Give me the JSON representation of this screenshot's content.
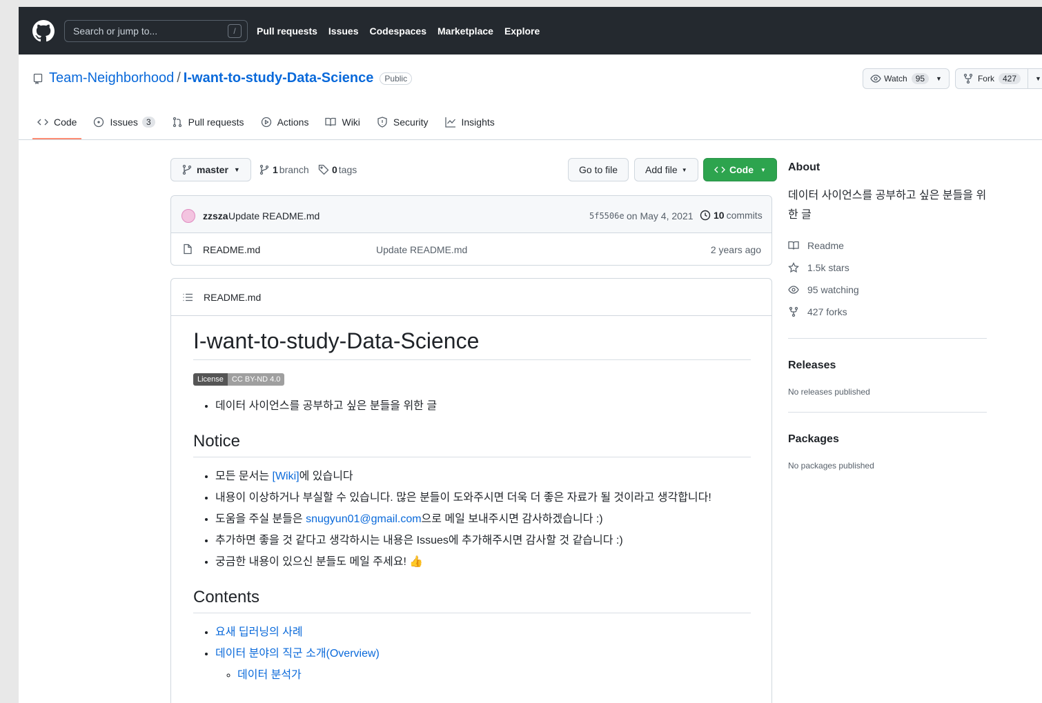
{
  "header": {
    "search_placeholder": "Search or jump to...",
    "slash": "/",
    "nav": [
      "Pull requests",
      "Issues",
      "Codespaces",
      "Marketplace",
      "Explore"
    ]
  },
  "repo": {
    "owner": "Team-Neighborhood",
    "separator": "/",
    "name": "I-want-to-study-Data-Science",
    "visibility": "Public",
    "watch_label": "Watch",
    "watch_count": "95",
    "fork_label": "Fork",
    "fork_count": "427"
  },
  "tabs": [
    {
      "label": "Code",
      "icon": "code-icon"
    },
    {
      "label": "Issues",
      "count": "3",
      "icon": "issue-icon"
    },
    {
      "label": "Pull requests",
      "icon": "pull-request-icon"
    },
    {
      "label": "Actions",
      "icon": "play-icon"
    },
    {
      "label": "Wiki",
      "icon": "book-icon"
    },
    {
      "label": "Security",
      "icon": "shield-icon"
    },
    {
      "label": "Insights",
      "icon": "graph-icon"
    }
  ],
  "branch": {
    "current": "master",
    "branch_count": "1",
    "branch_label": "branch",
    "tag_count": "0",
    "tag_label": "tags",
    "go_to_file": "Go to file",
    "add_file": "Add file",
    "code_button": "Code"
  },
  "commit": {
    "author": "zzsza",
    "message": "Update README.md",
    "sha": "5f5506e",
    "date": "on May 4, 2021",
    "commit_count": "10",
    "commit_label": "commits"
  },
  "files": [
    {
      "name": "README.md",
      "message": "Update README.md",
      "age": "2 years ago"
    }
  ],
  "readme": {
    "filename": "README.md",
    "title": "I-want-to-study-Data-Science",
    "license_left": "License",
    "license_right": "CC BY-ND 4.0",
    "intro": "데이터 사이언스를 공부하고 싶은 분들을 위한 글",
    "notice_heading": "Notice",
    "notice": {
      "item1_pre": "모든 문서는 ",
      "item1_link": "[Wiki]",
      "item1_post": "에 있습니다",
      "item2": "내용이 이상하거나 부실할 수 있습니다. 많은 분들이 도와주시면 더욱 더 좋은 자료가 될 것이라고 생각합니다!",
      "item3_pre": "도움을 주실 분들은 ",
      "item3_link": "snugyun01@gmail.com",
      "item3_post": "으로 메일 보내주시면 감사하겠습니다 :)",
      "item4": "추가하면 좋을 것 같다고 생각하시는 내용은 Issues에 추가해주시면 감사할 것 같습니다 :)",
      "item5": "궁금한 내용이 있으신 분들도 메일 주세요! 👍"
    },
    "contents_heading": "Contents",
    "contents": [
      "요새 딥러닝의 사례",
      "데이터 분야의 직군 소개(Overview)"
    ],
    "contents_sub": [
      "데이터 분석가"
    ]
  },
  "sidebar": {
    "about_heading": "About",
    "about_text": "데이터 사이언스를 공부하고 싶은 분들을 위한 글",
    "readme": "Readme",
    "stars": "1.5k stars",
    "watching": "95 watching",
    "forks": "427 forks",
    "releases_heading": "Releases",
    "releases_text": "No releases published",
    "packages_heading": "Packages",
    "packages_text": "No packages published"
  },
  "colors": {
    "header_bg": "#24292f",
    "link": "#0969da",
    "primary_button": "#2da44e",
    "tab_underline": "#fd8c73"
  }
}
